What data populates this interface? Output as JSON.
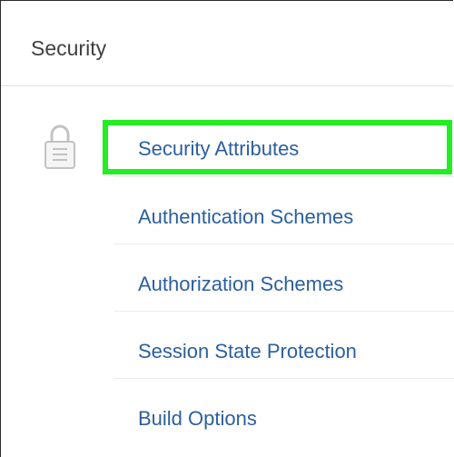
{
  "panel": {
    "title": "Security",
    "icon": "lock-icon"
  },
  "nav": {
    "items": [
      {
        "label": "Security Attributes"
      },
      {
        "label": "Authentication Schemes"
      },
      {
        "label": "Authorization Schemes"
      },
      {
        "label": "Session State Protection"
      },
      {
        "label": "Build Options"
      }
    ]
  },
  "colors": {
    "link": "#2b5f9e",
    "title": "#404040",
    "highlight": "#22ee22",
    "divider": "#ececec"
  }
}
